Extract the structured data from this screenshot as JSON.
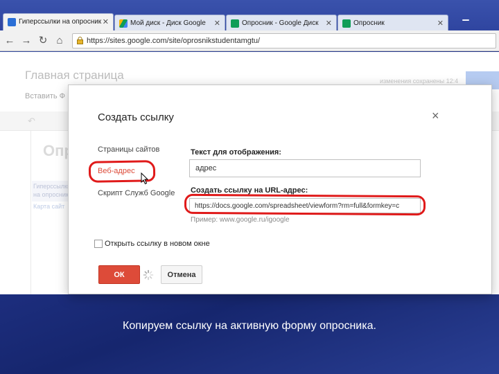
{
  "browser": {
    "tabs": [
      {
        "label": "Гиперссылки на опросник",
        "active": true,
        "icon": "sites-icon"
      },
      {
        "label": "Мой диск - Диск Google",
        "active": false,
        "icon": "drive-icon"
      },
      {
        "label": "Опросник - Google Диск",
        "active": false,
        "icon": "sheets-icon"
      },
      {
        "label": "Опросник",
        "active": false,
        "icon": "sheets-icon"
      }
    ],
    "url": "https://sites.google.com/site/oprosnikstudentamgtu/",
    "colors": {
      "tab_bar": "#3a52ac",
      "sites_icon": "#2b6fd6",
      "drive_icon": "#f4b400",
      "sheets_icon": "#0f9d58"
    }
  },
  "site": {
    "page_title": "Главная страница",
    "menu": "Вставить   Ф",
    "right_meta": "изменения сохранены 12:4",
    "heading": "Опр",
    "sidebar_item": "Гиперссылки на опросник",
    "sidebar_link": "Карта сайт"
  },
  "dialog": {
    "title": "Создать ссылку",
    "close_glyph": "×",
    "nav": {
      "site_pages": "Страницы сайтов",
      "web_address": "Веб-адрес",
      "apps_script": "Скрипт Служб Google"
    },
    "display_text_label": "Текст для отображения:",
    "display_text_value": "адрес",
    "url_label": "Создать ссылку на URL-адрес:",
    "url_value": "https://docs.google.com/spreadsheet/viewform?rm=full&formkey=c",
    "example": "Пример: www.google.ru/igoogle",
    "new_window_label": "Открыть ссылку в новом окне",
    "new_window_checked": false,
    "ok_label": "ОК",
    "cancel_label": "Отмена",
    "colors": {
      "ok": "#dd4b39",
      "highlight": "#e01a1a"
    }
  },
  "caption": "Копируем ссылку на активную форму опросника."
}
